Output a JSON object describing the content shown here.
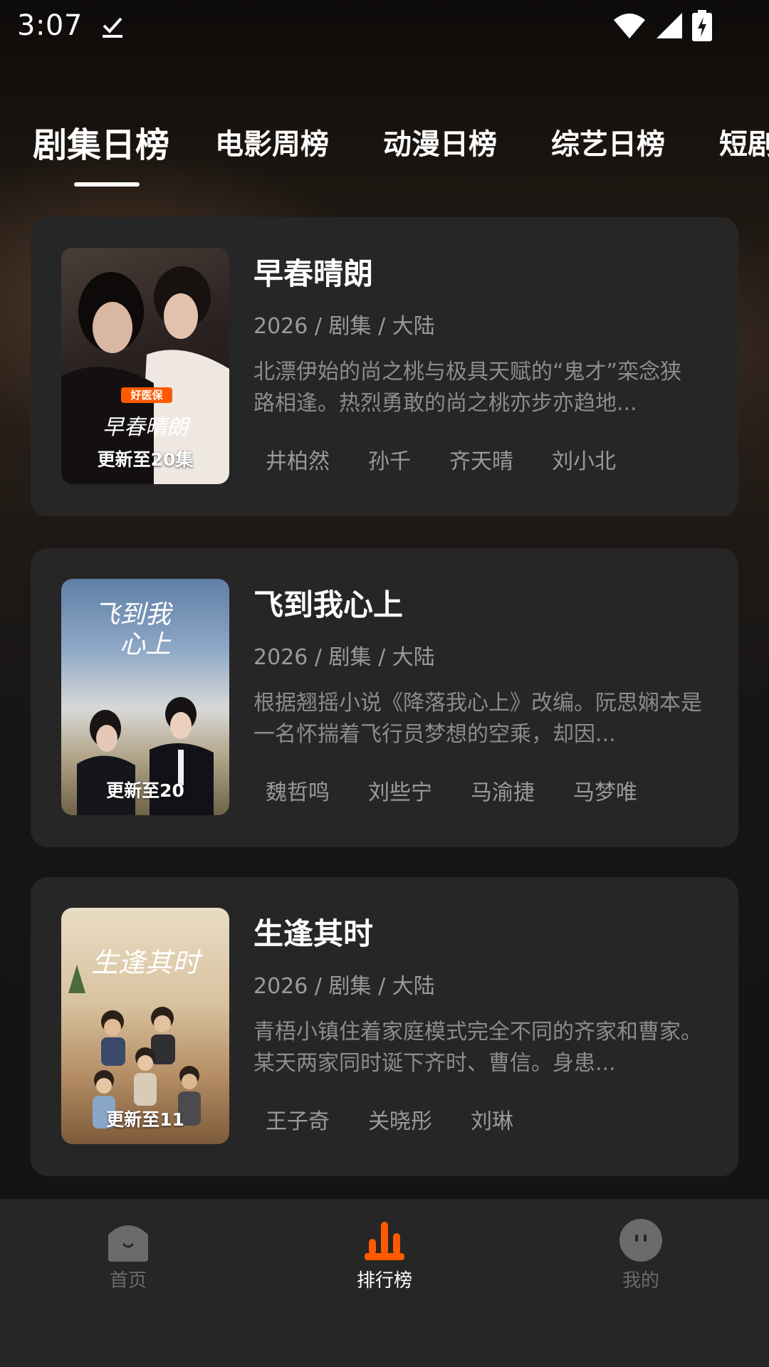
{
  "status_bar": {
    "time": "3:07"
  },
  "tabs": [
    {
      "label": "剧集日榜",
      "active": true
    },
    {
      "label": "电影周榜",
      "active": false
    },
    {
      "label": "动漫日榜",
      "active": false
    },
    {
      "label": "综艺日榜",
      "active": false
    },
    {
      "label": "短剧",
      "active": false
    }
  ],
  "cards": [
    {
      "title": "早春晴朗",
      "meta": "2026 / 剧集 / 大陆",
      "description": "北漂伊始的尚之桃与极具天赋的“鬼才”栾念狭路相逢。热烈勇敢的尚之桃亦步亦趋地...",
      "update_badge": "更新至20集",
      "poster_text": "早春晴朗",
      "poster_brand": "好医保",
      "cast": [
        "井柏然",
        "孙千",
        "齐天晴",
        "刘小北"
      ]
    },
    {
      "title": "飞到我心上",
      "meta": "2026 / 剧集 / 大陆",
      "description": "根据翘摇小说《降落我心上》改编。阮思娴本是一名怀揣着飞行员梦想的空乘，却因...",
      "update_badge": "更新至20",
      "poster_text": "飞到我心上",
      "cast": [
        "魏哲鸣",
        "刘些宁",
        "马渝捷",
        "马梦唯"
      ]
    },
    {
      "title": "生逢其时",
      "meta": "2026 / 剧集 / 大陆",
      "description": "青梧小镇住着家庭模式完全不同的齐家和曹家。某天两家同时诞下齐时、曹信。身患...",
      "update_badge": "更新至11",
      "poster_text": "生逢其时",
      "cast": [
        "王子奇",
        "关晓彤",
        "刘琳"
      ]
    }
  ],
  "bottom_nav": [
    {
      "label": "首页",
      "icon": "home-icon",
      "active": false
    },
    {
      "label": "排行榜",
      "icon": "ranking-icon",
      "active": true
    },
    {
      "label": "我的",
      "icon": "profile-icon",
      "active": false
    }
  ],
  "colors": {
    "accent": "#FF5A00",
    "card_bg": "#262626",
    "nav_bg": "#262626"
  }
}
